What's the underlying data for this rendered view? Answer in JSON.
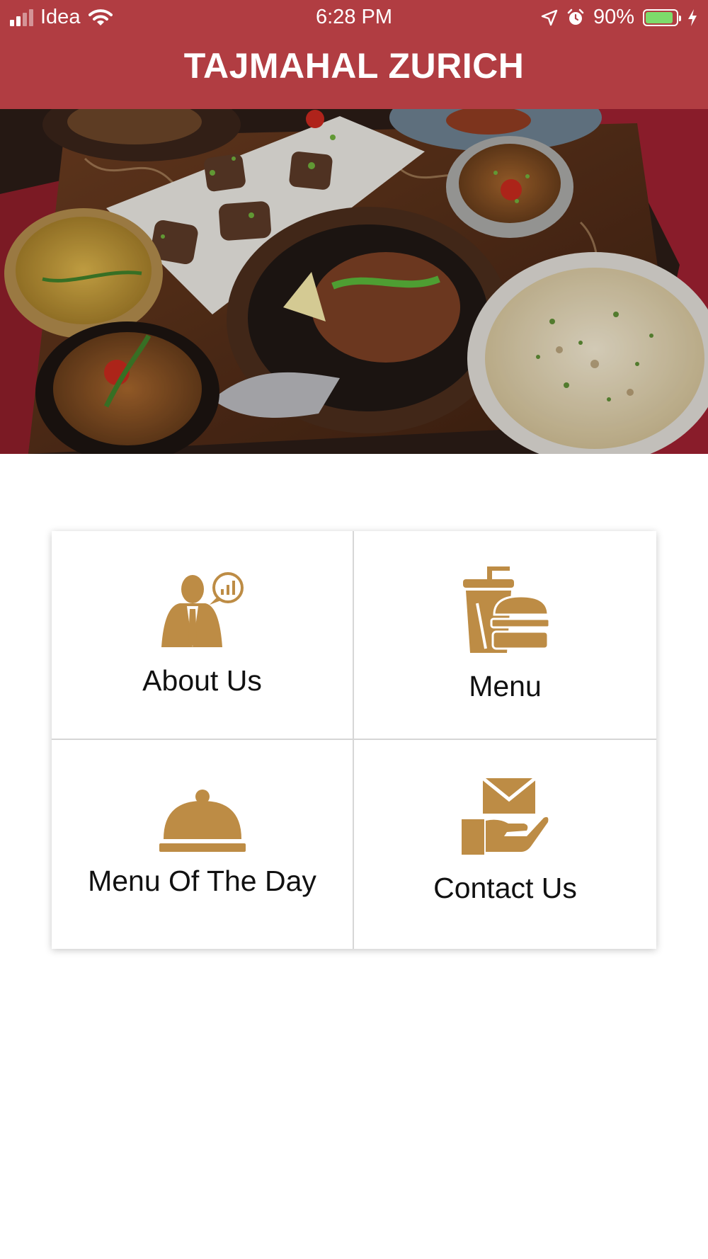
{
  "status_bar": {
    "carrier": "Idea",
    "time": "6:28 PM",
    "battery_percent": "90%",
    "battery_level": 0.9,
    "icons": [
      "signal-icon",
      "wifi-icon",
      "location-icon",
      "alarm-icon",
      "battery-icon",
      "charging-icon"
    ]
  },
  "header": {
    "title": "TAJMAHAL ZURICH",
    "background_color": "#b13d42"
  },
  "hero": {
    "image": "food-platter-photo"
  },
  "menu_tiles": [
    {
      "label": "About Us",
      "icon": "person-chat-icon"
    },
    {
      "label": "Menu",
      "icon": "drink-burger-icon"
    },
    {
      "label": "Menu Of The Day",
      "icon": "cloche-icon"
    },
    {
      "label": "Contact Us",
      "icon": "hand-envelope-icon"
    }
  ],
  "colors": {
    "accent": "#b13d42",
    "icon": "#bd8c45",
    "text": "#111111"
  }
}
